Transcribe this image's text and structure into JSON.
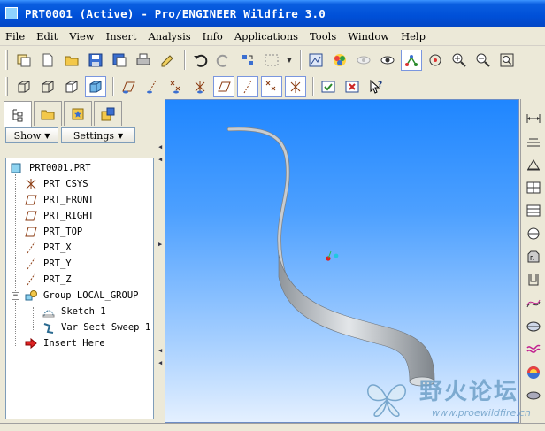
{
  "window": {
    "title": "PRT0001 (Active) - Pro/ENGINEER Wildfire 3.0"
  },
  "menu": [
    "File",
    "Edit",
    "View",
    "Insert",
    "Analysis",
    "Info",
    "Applications",
    "Tools",
    "Window",
    "Help"
  ],
  "panel": {
    "show_label": "Show",
    "settings_label": "Settings",
    "tree": [
      {
        "label": "PRT0001.PRT",
        "icon": "part-icon"
      },
      {
        "label": "PRT_CSYS",
        "icon": "csys-icon"
      },
      {
        "label": "PRT_FRONT",
        "icon": "datum-plane-icon"
      },
      {
        "label": "PRT_RIGHT",
        "icon": "datum-plane-icon"
      },
      {
        "label": "PRT_TOP",
        "icon": "datum-plane-icon"
      },
      {
        "label": "PRT_X",
        "icon": "datum-axis-icon"
      },
      {
        "label": "PRT_Y",
        "icon": "datum-axis-icon"
      },
      {
        "label": "PRT_Z",
        "icon": "datum-axis-icon"
      },
      {
        "label": "Group LOCAL_GROUP",
        "icon": "group-icon"
      },
      {
        "label": "Sketch 1",
        "icon": "sketch-icon"
      },
      {
        "label": "Var Sect Sweep 1",
        "icon": "sweep-icon"
      },
      {
        "label": "Insert Here",
        "icon": "insert-arrow-icon"
      }
    ]
  },
  "watermark": {
    "text": "野火论坛",
    "url": "www.proewildfire.cn"
  },
  "colors": {
    "titlebar": "#0050d8",
    "viewport_top": "#1f86ff",
    "viewport_bottom": "#e4f0ff",
    "model": "#c8ccd0"
  }
}
